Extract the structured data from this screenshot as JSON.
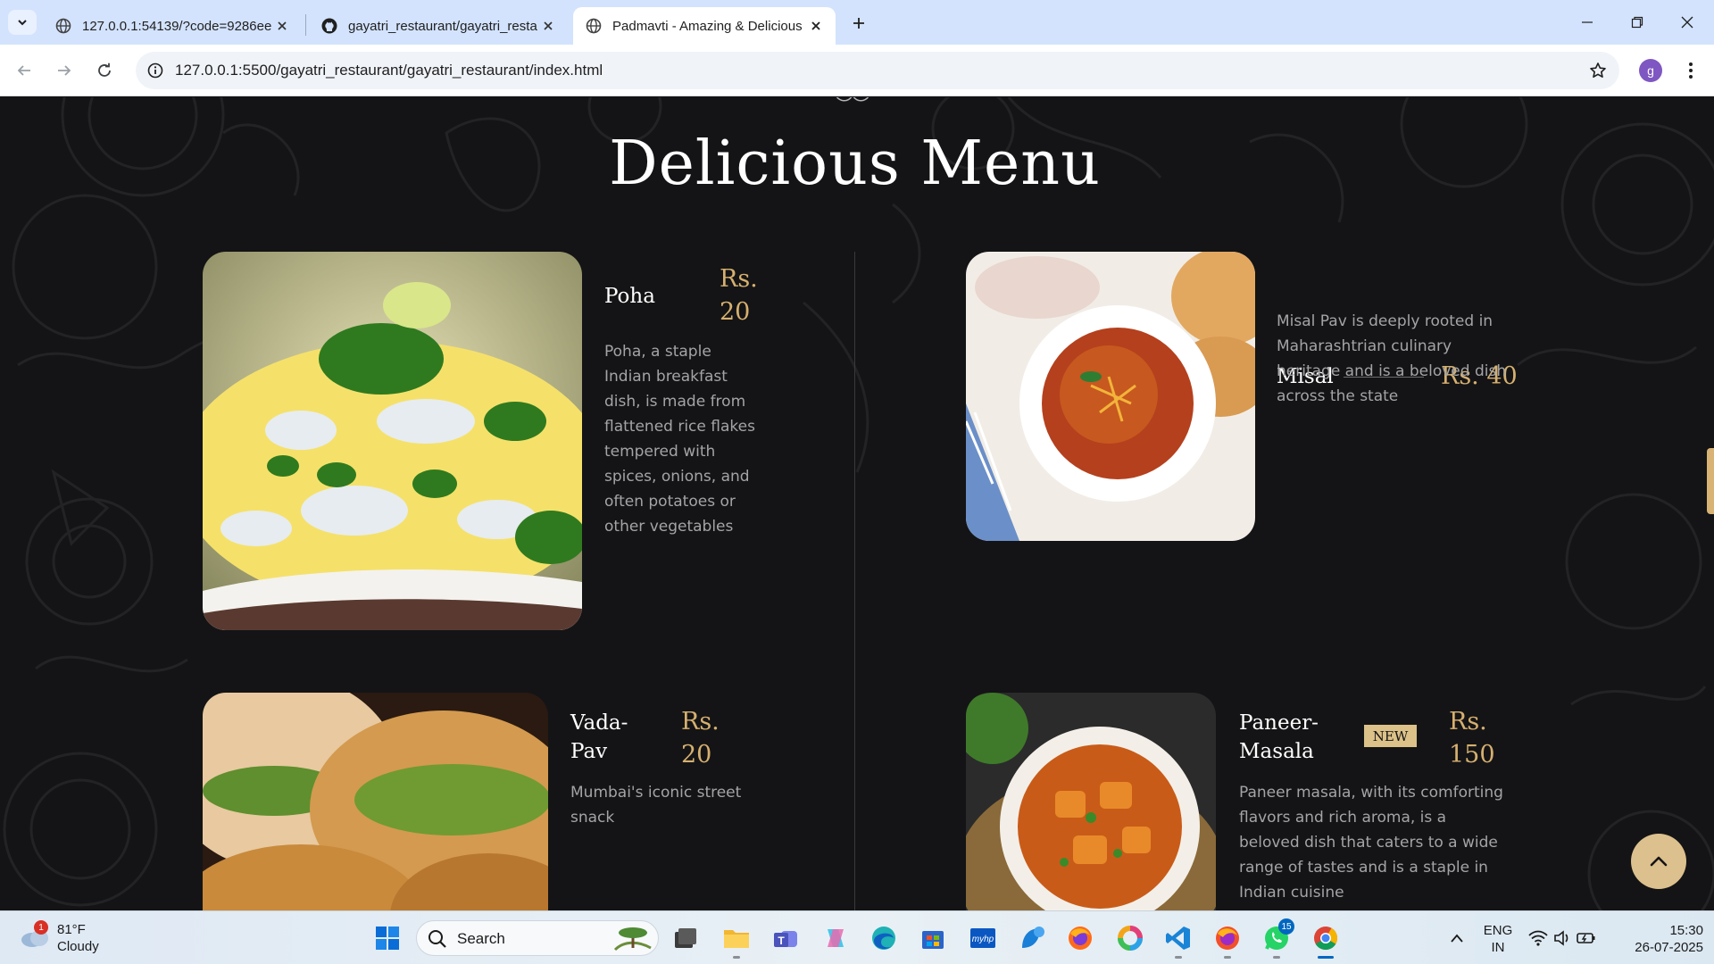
{
  "browser": {
    "tabs": [
      {
        "title": "127.0.0.1:54139/?code=9286ee",
        "active": false
      },
      {
        "title": "gayatri_restaurant/gayatri_resta",
        "active": false
      },
      {
        "title": "Padmavti - Amazing & Delicious",
        "active": true
      }
    ],
    "url": "127.0.0.1:5500/gayatri_restaurant/gayatri_restaurant/index.html",
    "profile_initial": "g"
  },
  "page": {
    "section_title": "Delicious Menu",
    "dishes": [
      {
        "name": "Poha",
        "price": "Rs. 20",
        "description": "Poha, a staple Indian breakfast dish, is made from flattened rice flakes tempered with spices, onions, and often potatoes or other vegetables"
      },
      {
        "name": "Misal",
        "price": "Rs. 40",
        "description": "Misal Pav is deeply rooted in Maharashtrian culinary heritage and is a beloved dish across the state"
      },
      {
        "name": "Vada-Pav",
        "price": "Rs. 20",
        "description": "Mumbai's iconic street snack"
      },
      {
        "name": "Paneer-Masala",
        "price": "Rs. 150",
        "badge": "NEW",
        "description": "Paneer masala, with its comforting flavors and rich aroma, is a beloved dish that caters to a wide range of tastes and is a staple in Indian cuisine"
      }
    ],
    "accent_color": "#d6b06f",
    "background_color": "#141416"
  },
  "taskbar": {
    "weather": {
      "temp": "81°F",
      "condition": "Cloudy",
      "badge": "1"
    },
    "search_label": "Search",
    "whatsapp_badge": "15",
    "language": {
      "line1": "ENG",
      "line2": "IN"
    },
    "clock": {
      "time": "15:30",
      "date": "26-07-2025"
    }
  }
}
